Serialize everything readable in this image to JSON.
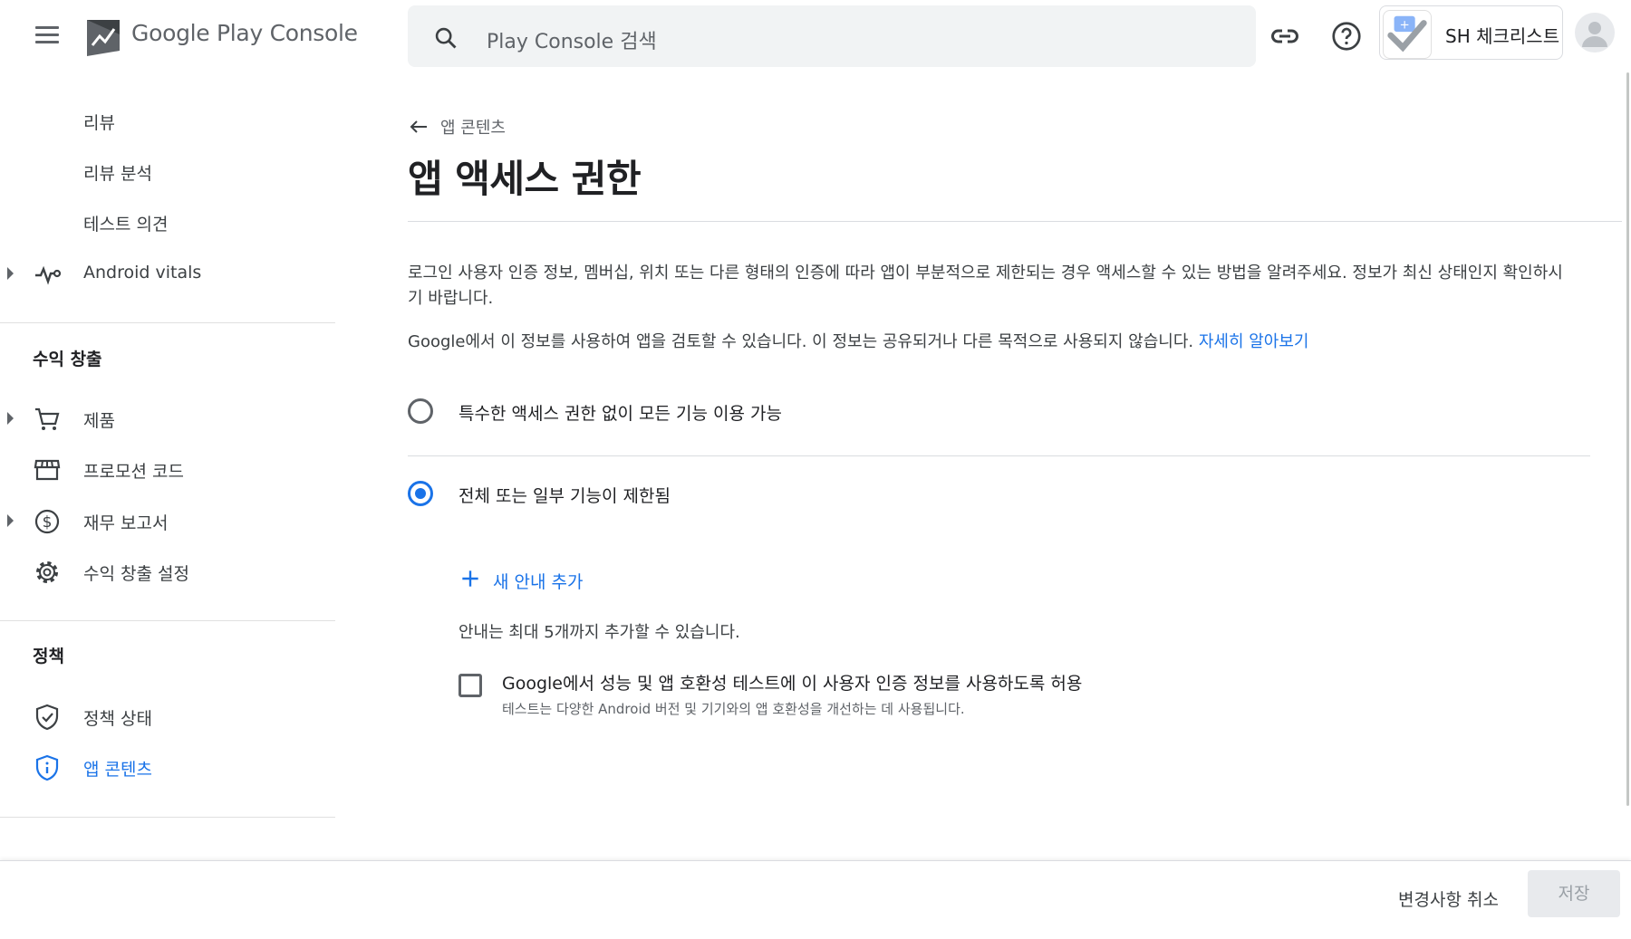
{
  "topbar": {
    "brand_google": "Google",
    "brand_play": "Play",
    "brand_console": "Console",
    "search_placeholder": "Play Console 검색",
    "app_name": "SH 체크리스트"
  },
  "sidebar": {
    "items_top": [
      {
        "label": "리뷰",
        "icon": ""
      },
      {
        "label": "리뷰 분석",
        "icon": ""
      },
      {
        "label": "테스트 의견",
        "icon": ""
      },
      {
        "label": "Android vitals",
        "icon": "vitals-icon"
      }
    ],
    "section_monetize": "수익 창출",
    "items_monetize": [
      {
        "label": "제품",
        "icon": "cart-icon"
      },
      {
        "label": "프로모션 코드",
        "icon": "store-icon"
      },
      {
        "label": "재무 보고서",
        "icon": "dollar-icon"
      },
      {
        "label": "수익 창출 설정",
        "icon": "gear-icon"
      }
    ],
    "section_policy": "정책",
    "items_policy": [
      {
        "label": "정책 상태",
        "icon": "shield-check-icon"
      },
      {
        "label": "앱 콘텐츠",
        "icon": "shield-info-icon"
      }
    ]
  },
  "main": {
    "back_label": "앱 콘텐츠",
    "title": "앱 액세스 권한",
    "description_1": "로그인 사용자 인증 정보, 멤버십, 위치 또는 다른 형태의 인증에 따라 앱이 부분적으로 제한되는 경우 액세스할 수 있는 방법을 알려주세요. 정보가 최신 상태인지 확인하시기 바랍니다.",
    "description_2": "Google에서 이 정보를 사용하여 앱을 검토할 수 있습니다. 이 정보는 공유되거나 다른 목적으로 사용되지 않습니다.",
    "learn_more": "자세히 알아보기",
    "option_all_available": "특수한 액세스 권한 없이 모든 기능 이용 가능",
    "option_restricted": "전체 또는 일부 기능이 제한됨",
    "selected_option": "option_restricted",
    "add_guide": "새 안내 추가",
    "guide_limit_note": "안내는 최대 5개까지 추가할 수 있습니다.",
    "checkbox_label": "Google에서 성능 및 앱 호환성 테스트에 이 사용자 인증 정보를 사용하도록 허용",
    "checkbox_help": "테스트는 다양한 Android 버전 및 기기와의 앱 호환성을 개선하는 데 사용됩니다.",
    "checkbox_checked": false
  },
  "footer": {
    "discard_label": "변경사항 취소",
    "save_label": "저장"
  },
  "colors": {
    "accent": "#1a73e8",
    "text": "#202124",
    "muted": "#5f6368"
  }
}
